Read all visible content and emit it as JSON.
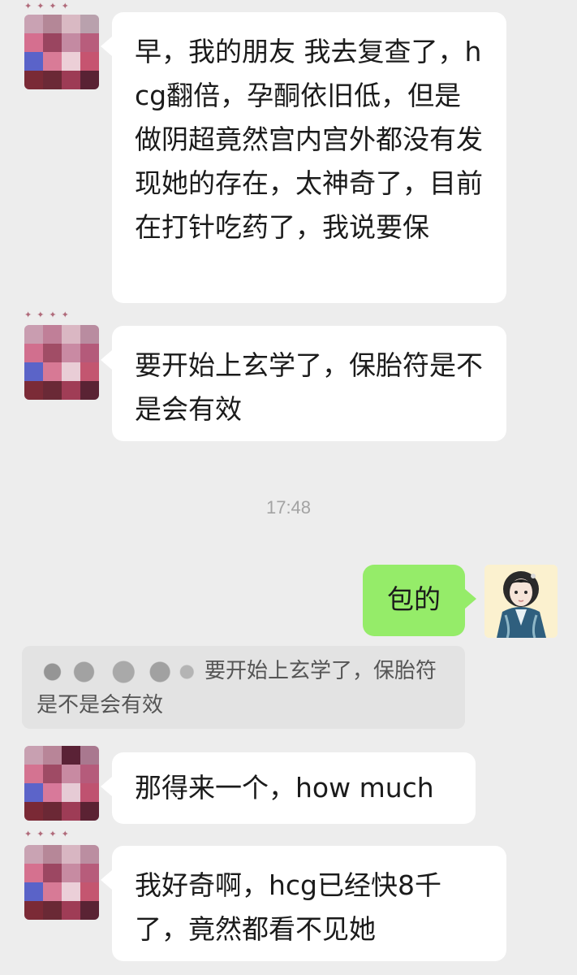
{
  "messages": [
    {
      "side": "left",
      "text": "早，我的朋友 我去复查了，hcg翻倍，孕酮依旧低，但是做阴超竟然宫内宫外都没有发现她的存在，太神奇了，目前在打针吃药了，我说要保"
    },
    {
      "side": "left",
      "text": "要开始上玄学了，保胎符是不是会有效"
    },
    {
      "side": "right",
      "text": "包的"
    },
    {
      "side": "left",
      "text": "那得来一个，how much"
    },
    {
      "side": "left",
      "text": "我好奇啊，hcg已经快8千了，竟然都看不见她"
    }
  ],
  "timestamp": "17:48",
  "quote": {
    "text": "要开始上玄学了，保胎符是不是会有效"
  },
  "colors": {
    "background": "#ededed",
    "incoming_bubble": "#ffffff",
    "outgoing_bubble": "#95ec69",
    "quote_bg": "#e3e3e3",
    "timestamp_text": "#a3a3a3"
  },
  "icons": {
    "contact_avatar": "pixelated-avatar-icon",
    "self_avatar": "anime-character-avatar-icon"
  }
}
